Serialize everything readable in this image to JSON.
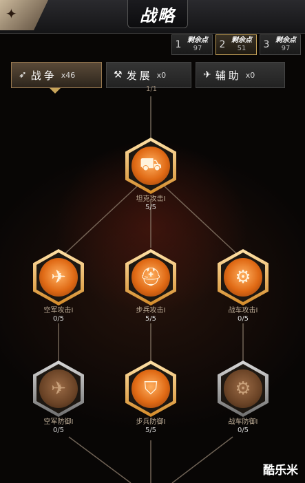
{
  "header": {
    "title": "战略"
  },
  "points": [
    {
      "num": "1",
      "label": "剩余点",
      "value": "97"
    },
    {
      "num": "2",
      "label": "剩余点",
      "value": "51"
    },
    {
      "num": "3",
      "label": "剩余点",
      "value": "97"
    }
  ],
  "tabs": [
    {
      "icon": "war-icon",
      "label": "战争",
      "count": "x46"
    },
    {
      "icon": "development-icon",
      "label": "发展",
      "count": "x0"
    },
    {
      "icon": "assist-icon",
      "label": "辅助",
      "count": "x0"
    }
  ],
  "top_fragment": {
    "progress": "1/1"
  },
  "nodes": {
    "tank_attack": {
      "name": "坦克攻击I",
      "progress": "5/5",
      "icon": "tank-icon"
    },
    "air_attack": {
      "name": "空军攻击I",
      "progress": "0/5",
      "icon": "aircraft-icon"
    },
    "infantry_attack": {
      "name": "步兵攻击I",
      "progress": "5/5",
      "icon": "helmet-icon"
    },
    "vehicle_attack": {
      "name": "战车攻击I",
      "progress": "0/5",
      "icon": "vehicle-icon"
    },
    "air_defense": {
      "name": "空军防御I",
      "progress": "0/5",
      "icon": "air-shield-icon"
    },
    "infantry_defense": {
      "name": "步兵防御I",
      "progress": "5/5",
      "icon": "shield-icon"
    },
    "vehicle_defense": {
      "name": "战车防御I",
      "progress": "0/5",
      "icon": "vehicle-shield-icon"
    }
  },
  "colors": {
    "accent": "#e07a20",
    "gold": "#c8a45a"
  },
  "watermark": "酷乐米"
}
